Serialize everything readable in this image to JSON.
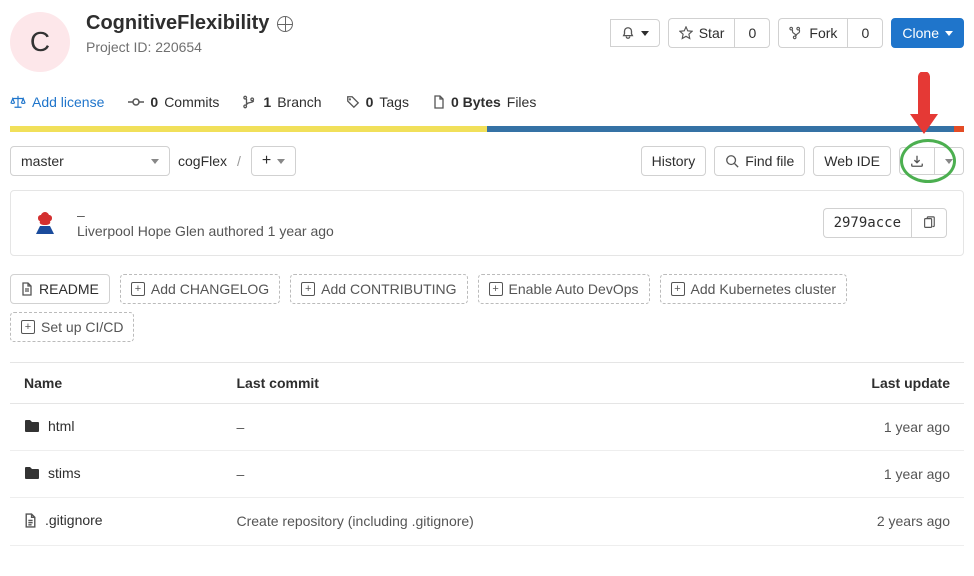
{
  "header": {
    "avatar_letter": "C",
    "project_name": "CognitiveFlexibility",
    "project_id_label": "Project ID: 220654",
    "star_label": "Star",
    "star_count": "0",
    "fork_label": "Fork",
    "fork_count": "0",
    "clone_label": "Clone"
  },
  "stats": {
    "add_license": "Add license",
    "commits_count": "0",
    "commits_label": "Commits",
    "branch_count": "1",
    "branch_label": "Branch",
    "tags_count": "0",
    "tags_label": "Tags",
    "bytes_count": "0 Bytes",
    "bytes_label": "Files"
  },
  "lang_bar": {
    "yellow_pct": 50,
    "blue_pct": 49,
    "orange_pct": 1
  },
  "tree": {
    "branch": "master",
    "breadcrumb_root": "cogFlex",
    "history_label": "History",
    "find_file_label": "Find file",
    "web_ide_label": "Web IDE"
  },
  "commit": {
    "title": "–",
    "meta": "Liverpool Hope Glen authored 1 year ago",
    "sha": "2979acce"
  },
  "suggestions": {
    "readme": "README",
    "changelog": "Add CHANGELOG",
    "contributing": "Add CONTRIBUTING",
    "autodevops": "Enable Auto DevOps",
    "kubernetes": "Add Kubernetes cluster",
    "cicd": "Set up CI/CD"
  },
  "table": {
    "col_name": "Name",
    "col_commit": "Last commit",
    "col_update": "Last update",
    "rows": [
      {
        "type": "folder",
        "name": "html",
        "commit": "–",
        "update": "1 year ago"
      },
      {
        "type": "folder",
        "name": "stims",
        "commit": "–",
        "update": "1 year ago"
      },
      {
        "type": "file",
        "name": ".gitignore",
        "commit": "Create repository (including .gitignore)",
        "update": "2 years ago"
      }
    ]
  }
}
